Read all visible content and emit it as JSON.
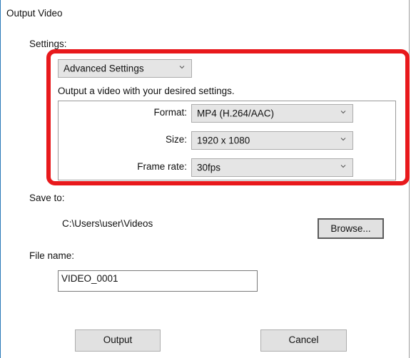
{
  "window": {
    "title": "Output Video"
  },
  "settings": {
    "label": "Settings:",
    "mode": {
      "value": "Advanced Settings"
    },
    "description": "Output a video with your desired settings.",
    "format": {
      "label": "Format:",
      "value": "MP4 (H.264/AAC)"
    },
    "size": {
      "label": "Size:",
      "value": "1920 x 1080"
    },
    "frame_rate": {
      "label": "Frame rate:",
      "value": "30fps"
    }
  },
  "save_to": {
    "label": "Save to:",
    "path": "C:\\Users\\user\\Videos",
    "browse_label": "Browse..."
  },
  "file_name": {
    "label": "File name:",
    "value": "VIDEO_0001"
  },
  "actions": {
    "output_label": "Output",
    "cancel_label": "Cancel"
  },
  "colors": {
    "highlight_frame": "#e8191c",
    "window_accent": "#2a7ab8"
  }
}
